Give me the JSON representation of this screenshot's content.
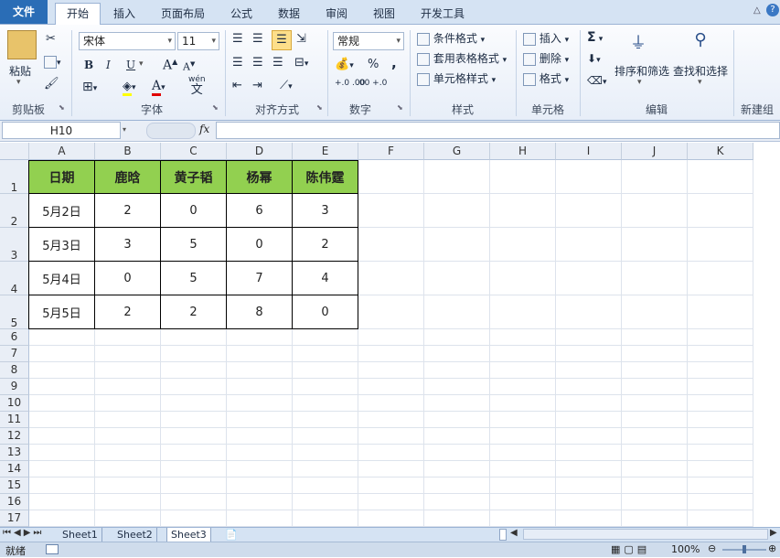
{
  "tabs": [
    "文件",
    "开始",
    "插入",
    "页面布局",
    "公式",
    "数据",
    "审阅",
    "视图",
    "开发工具"
  ],
  "clipboard": {
    "paste": "粘贴",
    "group": "剪贴板"
  },
  "font": {
    "name": "宋体",
    "size": "11",
    "group": "字体",
    "bold": "B",
    "italic": "I",
    "underline": "U",
    "grow": "A",
    "shrink": "A",
    "wen": "wén",
    "wen_char": "文"
  },
  "align": {
    "group": "对齐方式"
  },
  "number": {
    "format": "常规",
    "percent": "%",
    "comma": ",",
    "inc_dec": "+.0 .00",
    "dec_dec": ".00 +.0",
    "group": "数字"
  },
  "styles": {
    "cond": "条件格式",
    "table": "套用表格格式",
    "cell": "单元格样式",
    "group": "样式"
  },
  "cells": {
    "insert": "插入",
    "delete": "删除",
    "format": "格式",
    "group": "单元格"
  },
  "editing": {
    "sigma": "Σ",
    "sort": "排序和筛选",
    "find": "查找和选择",
    "group": "编辑"
  },
  "newgroup": "新建组",
  "formula": {
    "namebox": "H10",
    "fx": "fx",
    "value": ""
  },
  "columns": [
    "A",
    "B",
    "C",
    "D",
    "E",
    "F",
    "G",
    "H",
    "I",
    "J",
    "K"
  ],
  "rows": [
    "1",
    "2",
    "3",
    "4",
    "5",
    "6",
    "7",
    "8",
    "9",
    "10",
    "11",
    "12",
    "13",
    "14",
    "15",
    "16",
    "17"
  ],
  "table": {
    "header": [
      "日期",
      "鹿晗",
      "黄子韬",
      "杨幂",
      "陈伟霆"
    ],
    "data": [
      [
        "5月2日",
        "2",
        "0",
        "6",
        "3"
      ],
      [
        "5月3日",
        "3",
        "5",
        "0",
        "2"
      ],
      [
        "5月4日",
        "0",
        "5",
        "7",
        "4"
      ],
      [
        "5月5日",
        "2",
        "2",
        "8",
        "0"
      ]
    ]
  },
  "sheets": [
    "Sheet1",
    "Sheet2",
    "Sheet3"
  ],
  "status": {
    "ready": "就绪",
    "zoom": "100%"
  },
  "colors": {
    "header_fill": "#92d050",
    "file_tab": "#2a6db6"
  }
}
